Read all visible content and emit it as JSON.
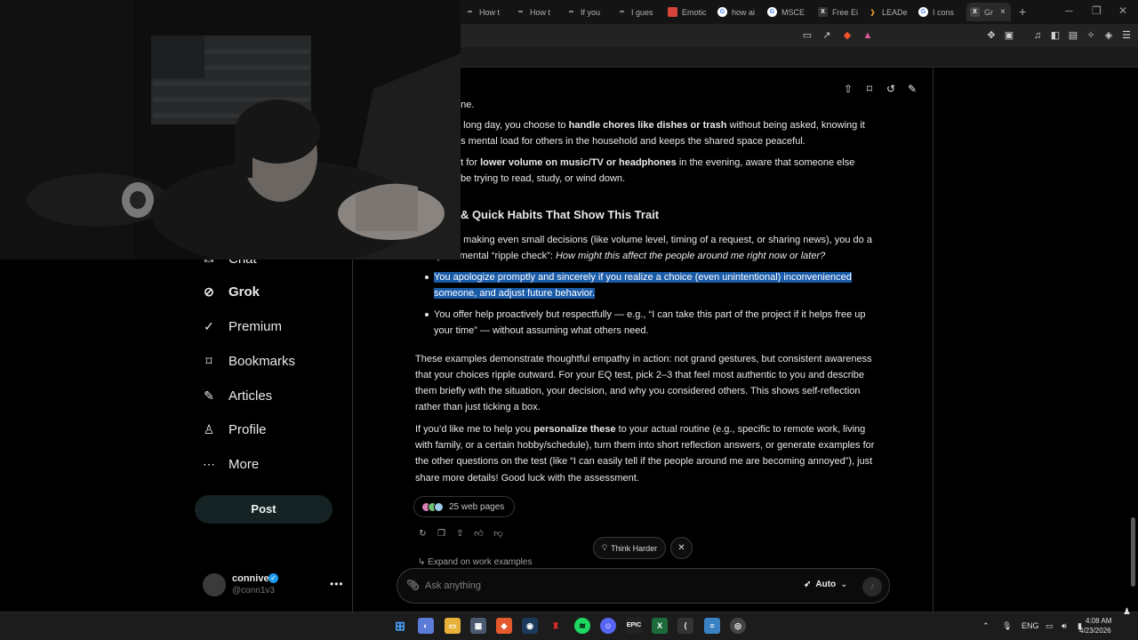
{
  "browser": {
    "tabs": [
      {
        "title": "How t",
        "icon": "meta-icon"
      },
      {
        "title": "How t",
        "icon": "meta-icon"
      },
      {
        "title": "If you",
        "icon": "meta-icon"
      },
      {
        "title": "I gues",
        "icon": "meta-icon"
      },
      {
        "title": "Emotic",
        "icon": "red-icon"
      },
      {
        "title": "how ai",
        "icon": "google-icon"
      },
      {
        "title": "MSCE",
        "icon": "google-icon"
      },
      {
        "title": "Free Ei",
        "icon": "x-icon"
      },
      {
        "title": "LEADe",
        "icon": "chevron-icon"
      },
      {
        "title": "I cons",
        "icon": "google-icon"
      },
      {
        "title": "Gr",
        "icon": "x-icon",
        "active": true
      }
    ],
    "new_tab": "+",
    "close_tab": "×"
  },
  "sidebar": {
    "items": [
      {
        "label": "Chat",
        "icon": "chat-icon"
      },
      {
        "label": "Grok",
        "icon": "grok-icon",
        "active": true
      },
      {
        "label": "Premium",
        "icon": "premium-icon"
      },
      {
        "label": "Bookmarks",
        "icon": "bookmark-icon"
      },
      {
        "label": "Articles",
        "icon": "articles-icon"
      },
      {
        "label": "Profile",
        "icon": "profile-icon"
      },
      {
        "label": "More",
        "icon": "more-icon"
      }
    ],
    "post_label": "Post",
    "user": {
      "name": "connive",
      "handle": "@conn1v3"
    }
  },
  "content": {
    "line_one": "one.",
    "p1_pre": "a long day, you choose to ",
    "p1_bold": "handle chores like dishes or trash",
    "p1_post": " without being asked, knowing it",
    "p1_line2": "es mental load for others in the household and keeps the shared space peaceful.",
    "p2_pre": "pt for ",
    "p2_bold": "lower volume on music/TV or headphones",
    "p2_post": " in the evening, aware that someone else",
    "p2_line2": "be trying to read, study, or wind down.",
    "heading": "t & Quick Habits That Show This Trait",
    "b1_line1": "e making even small decisions (like volume level, timing of a request, or sharing news), you do a",
    "b1_line2_pre": "quick mental “ripple check”: ",
    "b1_line2_italic": "How might this affect the people around me right now or later?",
    "b2_line1": "You apologize promptly and sincerely if you realize a choice (even unintentional) inconvenienced",
    "b2_line2": "someone, and adjust future behavior.",
    "b3_line1": "You offer help proactively but respectfully — e.g., “I can take this part of the project if it helps free up",
    "b3_line2": "your time” — without assuming what others need.",
    "para1": [
      "These examples demonstrate thoughtful empathy in action: not grand gestures, but consistent awareness",
      "that your choices ripple outward. For your EQ test, pick 2–3 that feel most authentic to you and describe",
      "them briefly with the situation, your decision, and why you considered others. This shows self-reflection",
      "rather than just ticking a box."
    ],
    "para2_l1_pre": "If you’d like me to help you ",
    "para2_l1_bold": "personalize these",
    "para2_l1_post": " to your actual routine (e.g., specific to remote work, living",
    "para2_rest": [
      "with family, or a certain hobby/schedule), turn them into short reflection answers, or generate examples for",
      "the other questions on the test (like “I can easily tell if the people around me are becoming annoyed”), just",
      "share more details! Good luck with the assessment."
    ],
    "web_pages": "25 web pages",
    "expand": "Expand on work examples",
    "think_harder": "Think Harder"
  },
  "composer": {
    "placeholder": "Ask anything",
    "mode": "Auto"
  },
  "taskbar": {
    "lang": "ENG",
    "time": "4:08 AM",
    "date": "4/23/2026"
  },
  "colors": {
    "highlight": "#1a5ba8",
    "accent": "#1d9bf0"
  }
}
